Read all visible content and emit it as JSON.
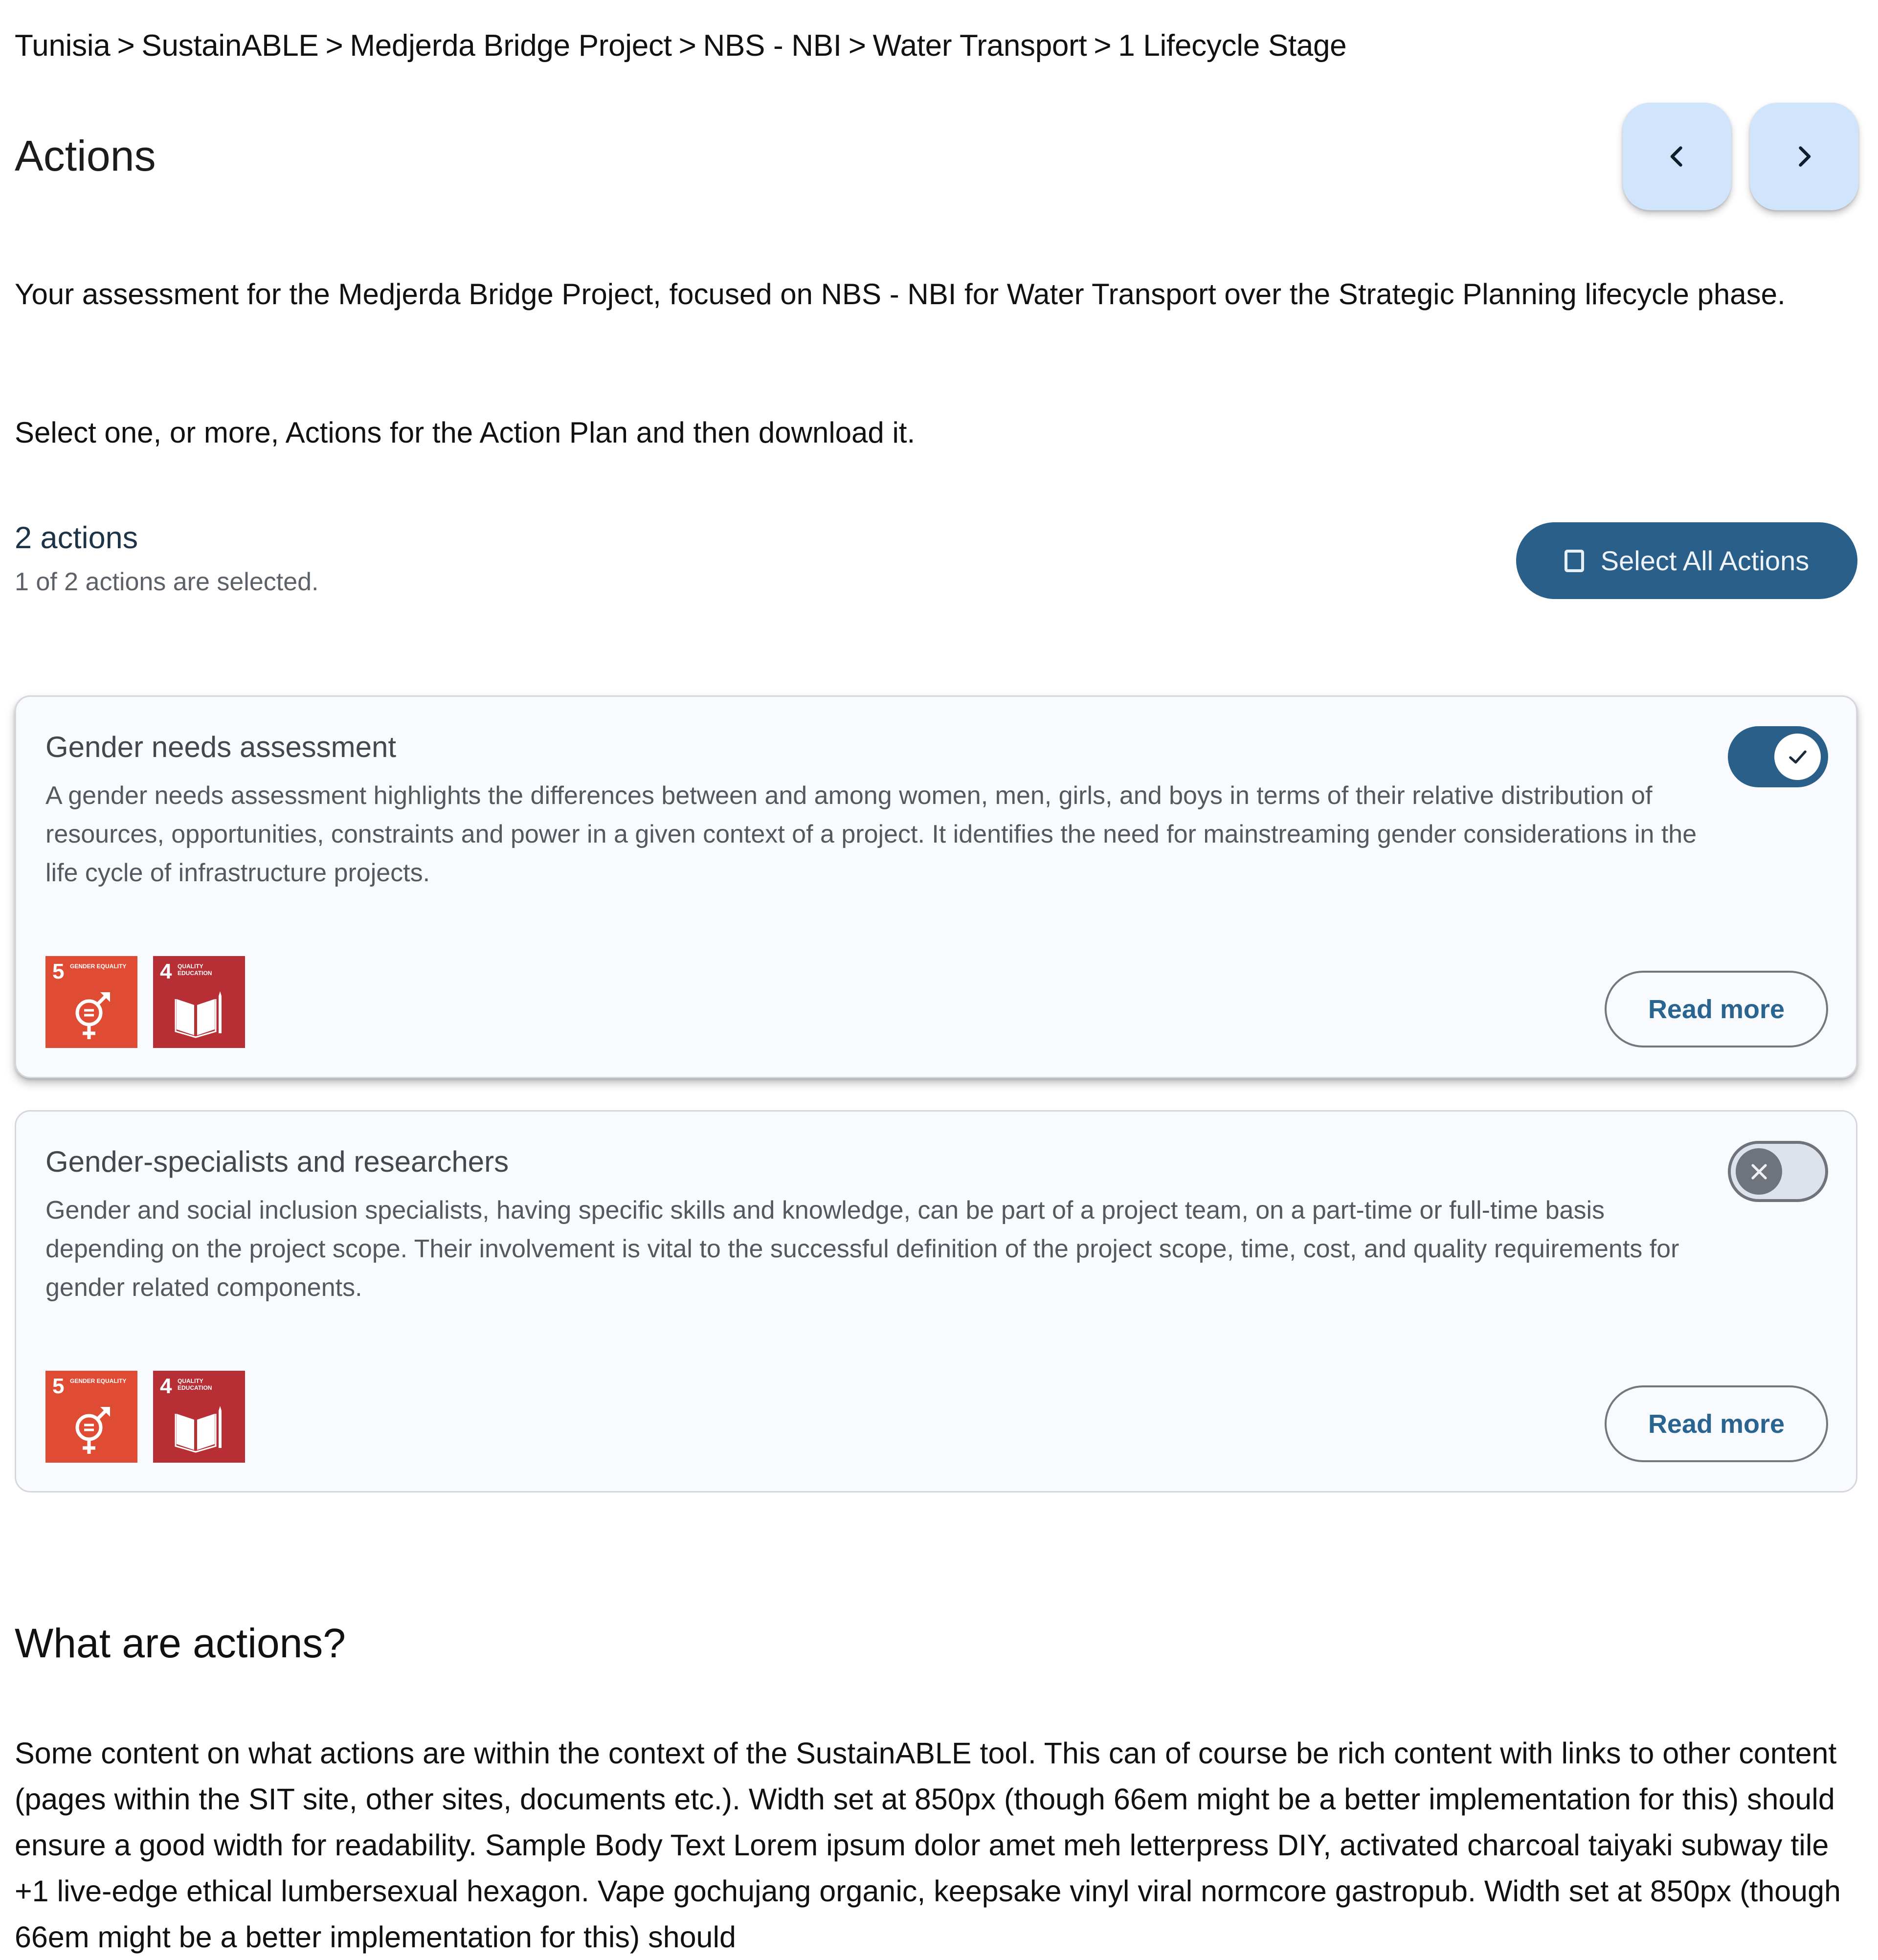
{
  "breadcrumb": {
    "items": [
      "Tunisia",
      "SustainABLE",
      "Medjerda Bridge Project",
      "NBS - NBI",
      "Water Transport",
      "1 Lifecycle Stage"
    ],
    "separator": ">"
  },
  "header": {
    "title": "Actions",
    "prev_icon": "chevron-left-icon",
    "next_icon": "chevron-right-icon"
  },
  "intro": {
    "assessment_text": "Your assessment for the Medjerda Bridge Project, focused on NBS - NBI for Water Transport over the Strategic Planning lifecycle phase.",
    "instruction_text": "Select one, or more, Actions for the Action Plan and then download it."
  },
  "summary": {
    "count_label": "2 actions",
    "selected_label": "1 of 2 actions are selected.",
    "select_all_label": "Select All Actions",
    "select_all_icon": "checkbox-outline-icon"
  },
  "colors": {
    "primary": "#2a5f8a",
    "nav_button_bg": "#d0e4fb",
    "card_bg": "#f9fafe",
    "sdg5": "#e04b34",
    "sdg4": "#b72e35"
  },
  "actions": [
    {
      "title": "Gender needs assessment",
      "description": "A gender needs assessment highlights the differences between and among women, men, girls, and boys in terms of their relative distribution of resources, opportunities, constraints and power in a given context of a project. It identifies the need for mainstreaming gender considerations in the life cycle of infrastructure projects.",
      "selected": true,
      "toggle_icon": "check-icon",
      "sdgs": [
        {
          "number": "5",
          "label": "Gender Equality",
          "icon": "gender-equality-icon"
        },
        {
          "number": "4",
          "label": "Quality Education",
          "icon": "book-pencil-icon"
        }
      ],
      "read_more_label": "Read more"
    },
    {
      "title": "Gender-specialists and researchers",
      "description": "Gender and social inclusion specialists, having specific skills and knowledge, can be part of a project team, on a part-time or full-time basis depending on the project scope. Their involvement is vital to the successful definition of the project scope, time, cost, and quality requirements for gender related components.",
      "selected": false,
      "toggle_icon": "close-icon",
      "sdgs": [
        {
          "number": "5",
          "label": "Gender Equality",
          "icon": "gender-equality-icon"
        },
        {
          "number": "4",
          "label": "Quality Education",
          "icon": "book-pencil-icon"
        }
      ],
      "read_more_label": "Read more"
    }
  ],
  "info_section": {
    "heading": "What are actions?",
    "body": "Some content on what actions are within the context of the SustainABLE tool. This can of course be rich content with links to other content (pages within the SIT site, other sites, documents etc.). Width set at 850px (though 66em might be a better implementation for this) should ensure a good width for readability. Sample Body Text Lorem ipsum dolor amet meh letterpress DIY, activated charcoal taiyaki subway tile +1 live-edge ethical lumbersexual hexagon. Vape gochujang organic, keepsake vinyl viral normcore gastropub. Width set at 850px (though 66em might be a better implementation for this) should"
  }
}
